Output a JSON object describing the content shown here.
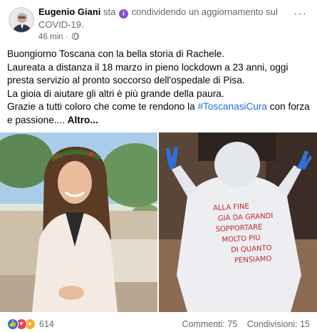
{
  "post": {
    "author": "Eugenio Giani",
    "activity_prefix": "sta",
    "activity_text": "condividendo un aggiornamento sul COVID-19.",
    "timestamp": "46 min",
    "timestamp_separator": "·",
    "more_options": "···",
    "text_lines": [
      "Buongiorno Toscana con la bella storia di Rachele.",
      "Laureata a distanza il 18 marzo in pieno lockdown a 23 anni, oggi",
      "presta servizio al pronto soccorso dell'ospedale di Pisa.",
      "La gioia di aiutare gli altri è più grande della paura.",
      "Grazie a tutti coloro che come te rendono la ",
      "e passione.... "
    ],
    "hashtag": "#ToscanasiCura",
    "hashtag_suffix": " con forza",
    "more_label": "Altro...",
    "suit_writing": [
      "ALLA FINE",
      "GIÀ DA GRANDI",
      "SOPPORTARE",
      "MOLTO PIÙ",
      "DI QUANTO",
      "PENSIAMO"
    ]
  },
  "footer": {
    "reaction_count": "614",
    "comments": "Commenti: 75",
    "shares": "Condivisioni: 15"
  },
  "icons": [
    "avatar",
    "feeling-icon",
    "globe-icon",
    "more-options-icon",
    "like-reaction-icon",
    "love-reaction-icon",
    "care-reaction-icon"
  ],
  "colors": {
    "link": "#216fdb",
    "muted": "#65676b",
    "like": "#1877f2",
    "love": "#f33e58",
    "care": "#f7b125",
    "feeling": "#8a4dd6"
  }
}
